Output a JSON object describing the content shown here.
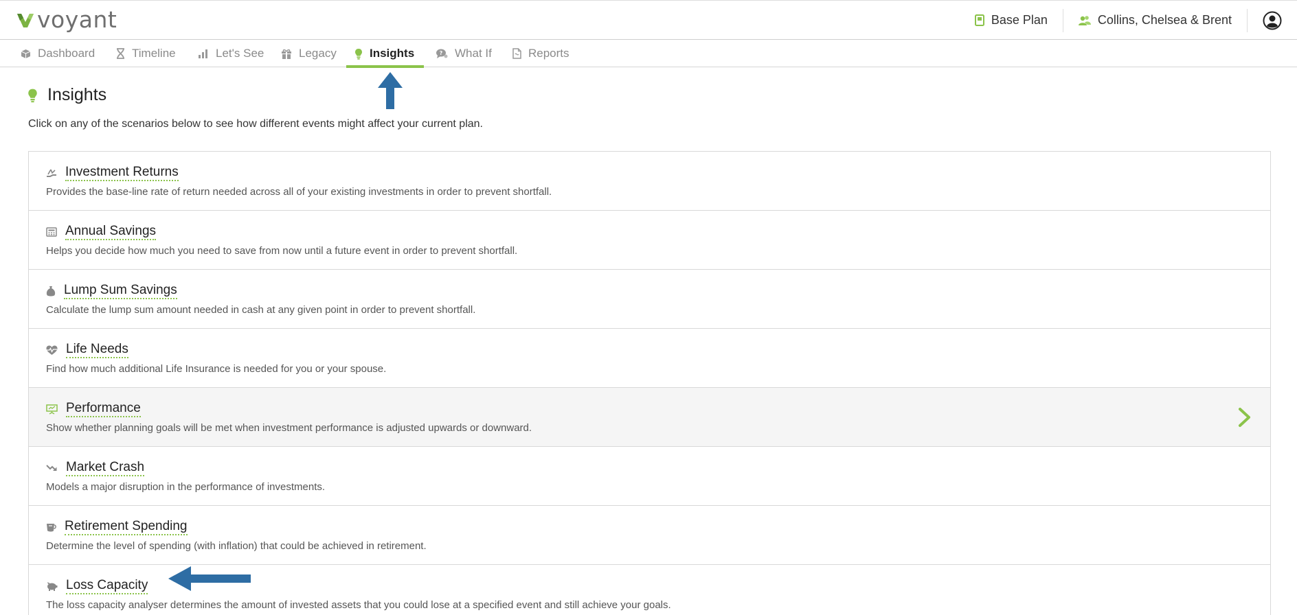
{
  "app": {
    "logo_text": "voyant"
  },
  "header": {
    "plan_label": "Base Plan",
    "client_label": "Collins, Chelsea & Brent",
    "accent_color": "#8bc34a"
  },
  "nav": {
    "tabs": [
      {
        "label": "Dashboard",
        "icon": "cube-icon"
      },
      {
        "label": "Timeline",
        "icon": "hourglass-icon"
      },
      {
        "label": "Let's See",
        "icon": "bar-chart-icon"
      },
      {
        "label": "Legacy",
        "icon": "gift-icon"
      },
      {
        "label": "Insights",
        "icon": "lightbulb-icon",
        "active": true
      },
      {
        "label": "What If",
        "icon": "question-bubble-icon"
      },
      {
        "label": "Reports",
        "icon": "document-icon"
      }
    ]
  },
  "page": {
    "title": "Insights",
    "intro": "Click on any of the scenarios below to see how different events might affect your current plan."
  },
  "scenarios": [
    {
      "title": "Investment Returns",
      "description": "Provides the base-line rate of return needed across all of your existing investments in order to prevent shortfall.",
      "icon": "hand-growth-icon"
    },
    {
      "title": "Annual Savings",
      "description": "Helps you decide how much you need to save from now until a future event in order to prevent shortfall.",
      "icon": "calculator-icon"
    },
    {
      "title": "Lump Sum Savings",
      "description": "Calculate the lump sum amount needed in cash at any given point in order to prevent shortfall.",
      "icon": "money-bag-icon"
    },
    {
      "title": "Life Needs",
      "description": "Find how much additional Life Insurance is needed for you or your spouse.",
      "icon": "heartbeat-icon"
    },
    {
      "title": "Performance",
      "description": "Show whether planning goals will be met when investment performance is adjusted upwards or downward.",
      "icon": "presentation-icon",
      "hovered": true
    },
    {
      "title": "Market Crash",
      "description": "Models a major disruption in the performance of investments.",
      "icon": "trend-down-icon"
    },
    {
      "title": "Retirement Spending",
      "description": "Determine the level of spending (with inflation) that could be achieved in retirement.",
      "icon": "cup-icon"
    },
    {
      "title": "Loss Capacity",
      "description": "The loss capacity analyser determines the amount of invested assets that you could lose at a specified event and still achieve your goals.",
      "icon": "piggy-bank-icon"
    }
  ],
  "annotations": {
    "arrow_color": "#2e6da4"
  }
}
